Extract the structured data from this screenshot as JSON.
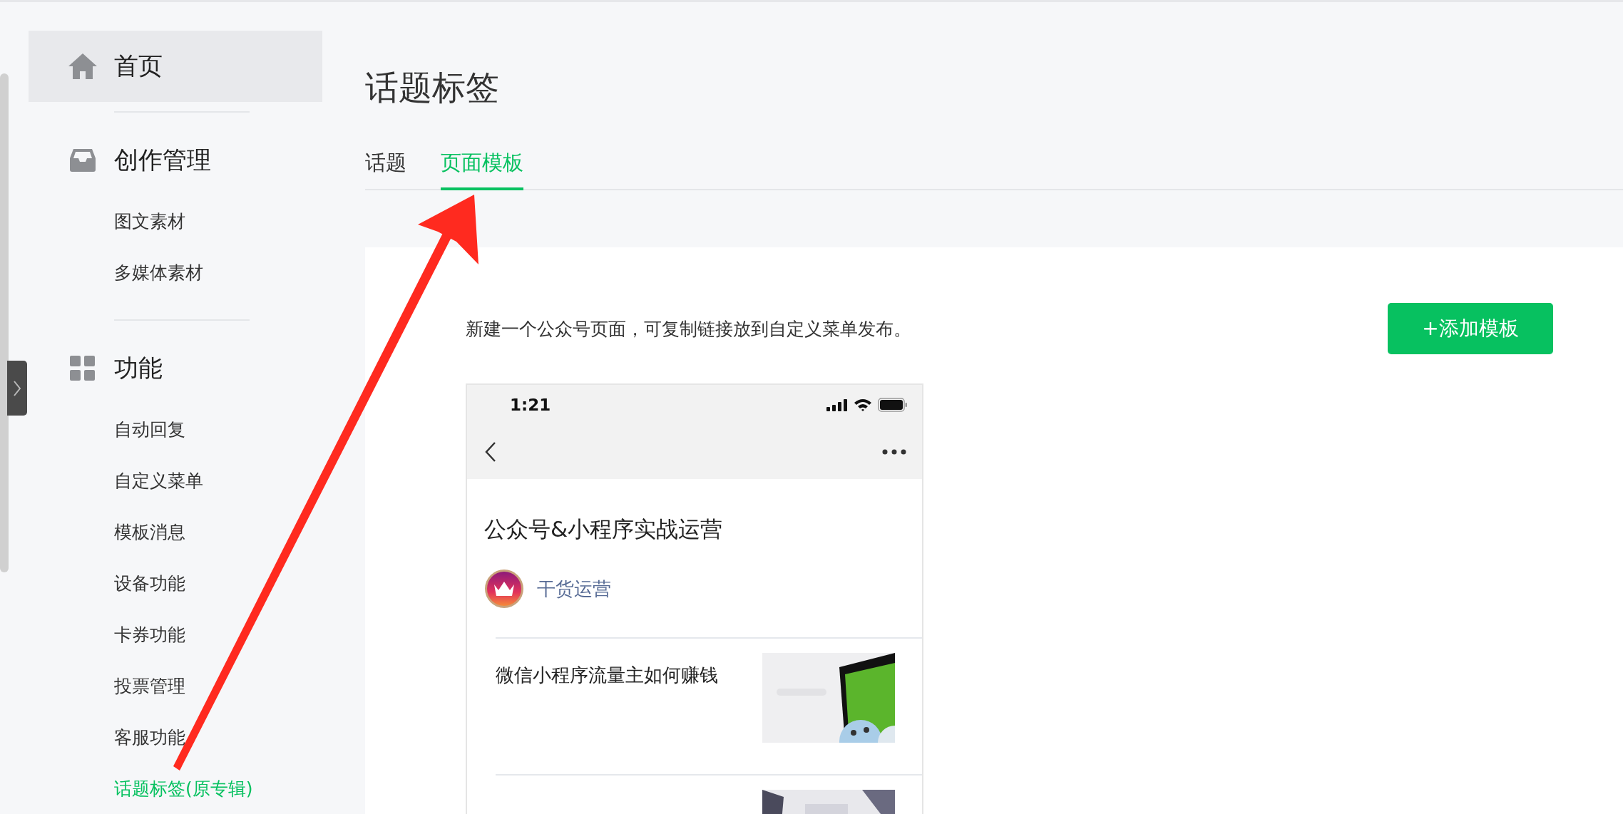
{
  "sidebar": {
    "sections": [
      {
        "kind": "home",
        "title": "首页",
        "highlighted": true
      },
      {
        "kind": "inbox",
        "title": "创作管理",
        "highlighted": false,
        "items": [
          {
            "label": "图文素材",
            "selected": false
          },
          {
            "label": "多媒体素材",
            "selected": false
          }
        ]
      },
      {
        "kind": "grid",
        "title": "功能",
        "highlighted": false,
        "items": [
          {
            "label": "自动回复",
            "selected": false
          },
          {
            "label": "自定义菜单",
            "selected": false
          },
          {
            "label": "模板消息",
            "selected": false
          },
          {
            "label": "设备功能",
            "selected": false
          },
          {
            "label": "卡券功能",
            "selected": false
          },
          {
            "label": "投票管理",
            "selected": false
          },
          {
            "label": "客服功能",
            "selected": false
          },
          {
            "label": "话题标签(原专辑)",
            "selected": true
          }
        ]
      }
    ]
  },
  "page": {
    "title": "话题标签",
    "tabs": [
      {
        "label": "话题",
        "selected": false
      },
      {
        "label": "页面模板",
        "selected": true
      }
    ],
    "description": "新建一个公众号页面，可复制链接放到自定义菜单发布。",
    "add_button": "+添加模板",
    "preview": {
      "time": "1:21",
      "article_title": "公众号&小程序实战运营",
      "author": "干货运营",
      "articles": [
        {
          "title": "微信小程序流量主如何赚钱",
          "thumbnail": {
            "kind": "picture"
          }
        },
        {
          "thumbnail": {
            "kind": "picture"
          }
        }
      ]
    }
  }
}
